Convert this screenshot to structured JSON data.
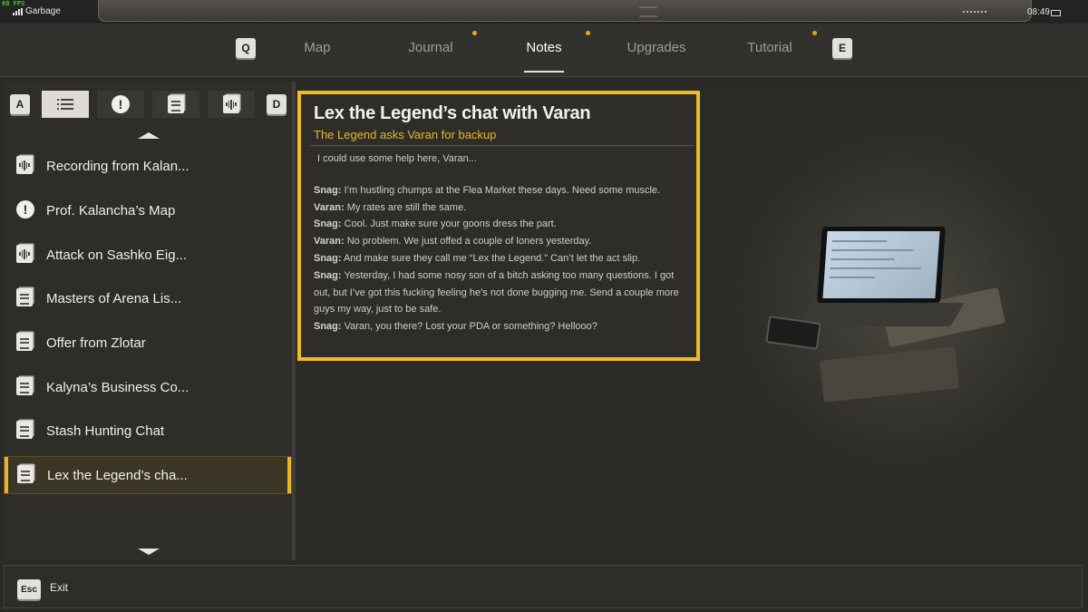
{
  "status_bar": {
    "fps": "60 FPS",
    "carrier": "Garbage",
    "time": "08:49"
  },
  "nav": {
    "prev_key": "Q",
    "next_key": "E",
    "tabs": [
      {
        "label": "Map",
        "active": false,
        "notification": false
      },
      {
        "label": "Journal",
        "active": false,
        "notification": true
      },
      {
        "label": "Notes",
        "active": true,
        "notification": true
      },
      {
        "label": "Upgrades",
        "active": false,
        "notification": false
      },
      {
        "label": "Tutorial",
        "active": false,
        "notification": true
      }
    ]
  },
  "filters": {
    "prev_key": "A",
    "next_key": "D",
    "buttons": [
      {
        "icon": "list-icon",
        "active": true
      },
      {
        "icon": "exclamation-icon",
        "active": false
      },
      {
        "icon": "note-icon",
        "active": false
      },
      {
        "icon": "audio-note-icon",
        "active": false
      }
    ]
  },
  "notes_list": [
    {
      "label": "Recording from Kalan...",
      "icon": "audio-note-icon",
      "selected": false
    },
    {
      "label": "Prof. Kalancha’s Map",
      "icon": "exclamation-icon",
      "selected": false
    },
    {
      "label": "Attack on Sashko Eig...",
      "icon": "audio-note-icon",
      "selected": false
    },
    {
      "label": "Masters of Arena Lis...",
      "icon": "note-icon",
      "selected": false
    },
    {
      "label": "Offer from Zlotar",
      "icon": "note-icon",
      "selected": false
    },
    {
      "label": "Kalyna’s Business Co...",
      "icon": "note-icon",
      "selected": false
    },
    {
      "label": "Stash Hunting Chat",
      "icon": "note-icon",
      "selected": false
    },
    {
      "label": "Lex the Legend’s cha...",
      "icon": "note-icon",
      "selected": true
    }
  ],
  "note": {
    "title": "Lex the Legend’s chat with Varan",
    "subtitle": "The Legend asks Varan for backup",
    "intro": "I could use some help here, Varan...",
    "lines": [
      {
        "speaker": "Snag:",
        "text": " I’m hustling chumps at the Flea Market these days. Need some muscle."
      },
      {
        "speaker": "Varan:",
        "text": " My rates are still the same."
      },
      {
        "speaker": "Snag:",
        "text": " Cool. Just make sure your goons dress the part."
      },
      {
        "speaker": "Varan:",
        "text": " No problem. We just offed a couple of loners yesterday."
      },
      {
        "speaker": "Snag:",
        "text": " And make sure they call me “Lex the Legend.” Can’t let the act slip."
      },
      {
        "speaker": "Snag:",
        "text": " Yesterday, I had some nosy son of a bitch asking too many questions. I got out, but I’ve got this fucking feeling he’s not done bugging me. Send a couple more guys my way, just to be safe."
      },
      {
        "speaker": "Snag:",
        "text": " Varan, you there? Lost your PDA or something? Hellooo?"
      }
    ]
  },
  "footer": {
    "key": "Esc",
    "label": "Exit"
  },
  "colors": {
    "accent": "#f0bc1f",
    "subtitle": "#eab628",
    "background": "#2b2a27"
  }
}
